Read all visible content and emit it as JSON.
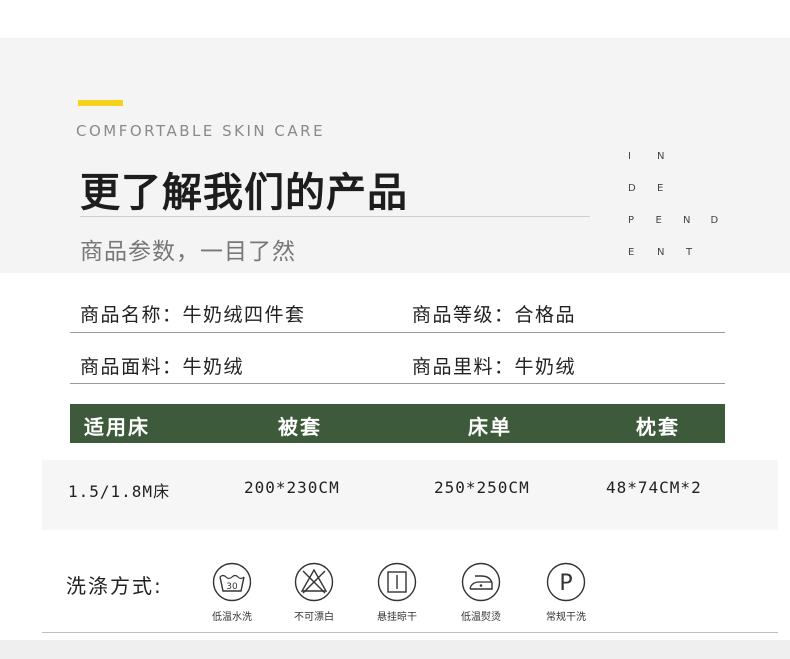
{
  "header": {
    "kicker": "COMFORTABLE SKIN CARE",
    "title": "更了解我们的产品",
    "subtitle": "商品参数，一目了然",
    "vertical_letters": [
      [
        "I",
        "N"
      ],
      [
        "D",
        "E"
      ],
      [
        "P",
        "E",
        "N",
        "D"
      ],
      [
        "E",
        "N",
        "T"
      ]
    ]
  },
  "info": {
    "row1": {
      "left": "商品名称：牛奶绒四件套",
      "right": "商品等级：合格品"
    },
    "row2": {
      "left": "商品面料：牛奶绒",
      "right": "商品里料：牛奶绒"
    }
  },
  "size_table": {
    "columns": [
      "适用床",
      "被套",
      "床单",
      "枕套"
    ],
    "row": [
      "1.5/1.8M床",
      "200*230CM",
      "250*250CM",
      "48*74CM*2"
    ]
  },
  "care": {
    "label": "洗涤方式:",
    "items": [
      {
        "icon": "wash-30-icon",
        "caption": "低温水洗",
        "number": "30"
      },
      {
        "icon": "no-bleach-icon",
        "caption": "不可漂白"
      },
      {
        "icon": "hang-dry-icon",
        "caption": "悬挂晾干"
      },
      {
        "icon": "low-iron-icon",
        "caption": "低温熨烫"
      },
      {
        "icon": "dry-clean-p-icon",
        "caption": "常规干洗",
        "letter": "P"
      }
    ]
  },
  "colors": {
    "accent": "#f5d21c",
    "table_header": "#3d5a3a",
    "text": "#222222",
    "muted": "#8a8a8a"
  }
}
